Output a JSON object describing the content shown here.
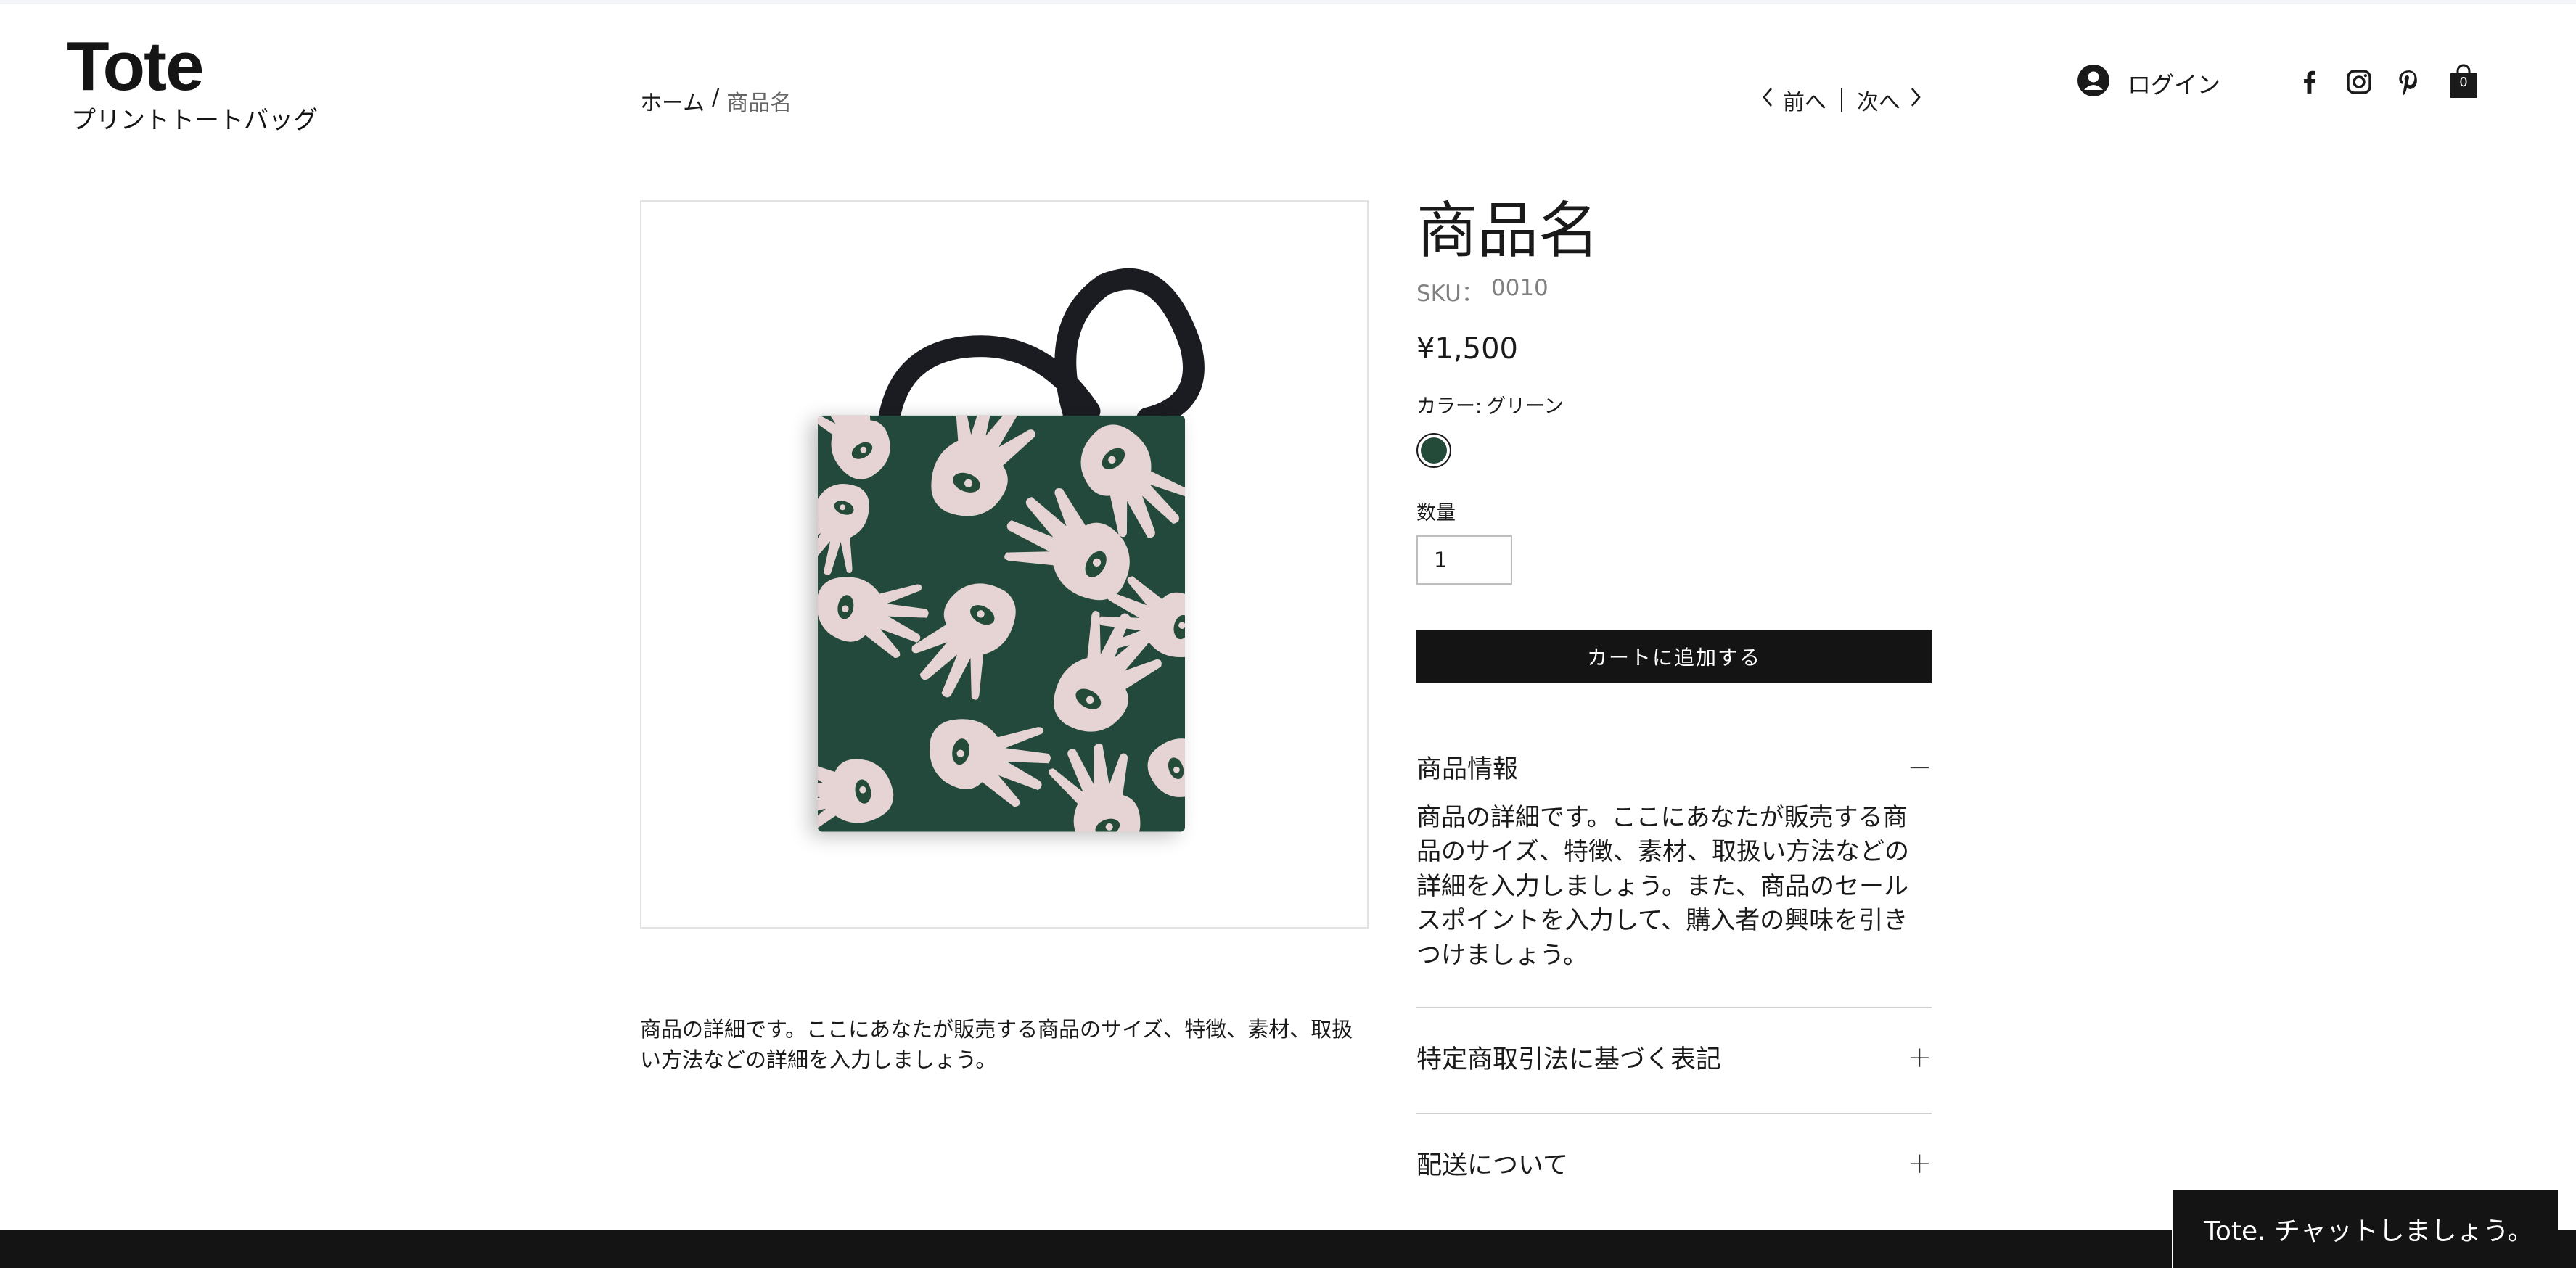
{
  "brand": {
    "name": "Tote",
    "subtitle": "プリントトートバッグ"
  },
  "breadcrumb": {
    "home": "ホーム",
    "separator": "/",
    "current": "商品名"
  },
  "nav": {
    "prev": "前へ",
    "next": "次へ"
  },
  "header": {
    "login": "ログイン",
    "social_icons": [
      "facebook-icon",
      "instagram-icon",
      "pinterest-icon"
    ],
    "cart_count": "0"
  },
  "product": {
    "name": "商品名",
    "sku_label": "SKU：",
    "sku_value": "0010",
    "price": "¥1,500",
    "color_label": "カラー:",
    "color_value": "グリーン",
    "color_hex": "#244a3a",
    "quantity_label": "数量",
    "quantity_value": "1",
    "add_to_cart": "カートに追加する",
    "short_description": "商品の詳細です。ここにあなたが販売する商品のサイズ、特徴、素材、取扱い方法などの詳細を入力しましょう。"
  },
  "accordion": [
    {
      "title": "商品情報",
      "expanded": true,
      "icon": "−",
      "body": "商品の詳細です。ここにあなたが販売する商品のサイズ、特徴、素材、取扱い方法などの詳細を入力しましょう。また、商品のセールスポイントを入力して、購入者の興味を引きつけましょう。"
    },
    {
      "title": "特定商取引法に基づく表記",
      "expanded": false,
      "icon": "+"
    },
    {
      "title": "配送について",
      "expanded": false,
      "icon": "+"
    }
  ],
  "chat": {
    "label": "Tote. チャットしましょう。"
  },
  "colors": {
    "bag_green": "#244a3a",
    "bag_pattern": "#e6d3d3",
    "strap": "#1b1c22",
    "button_dark": "#141414"
  }
}
